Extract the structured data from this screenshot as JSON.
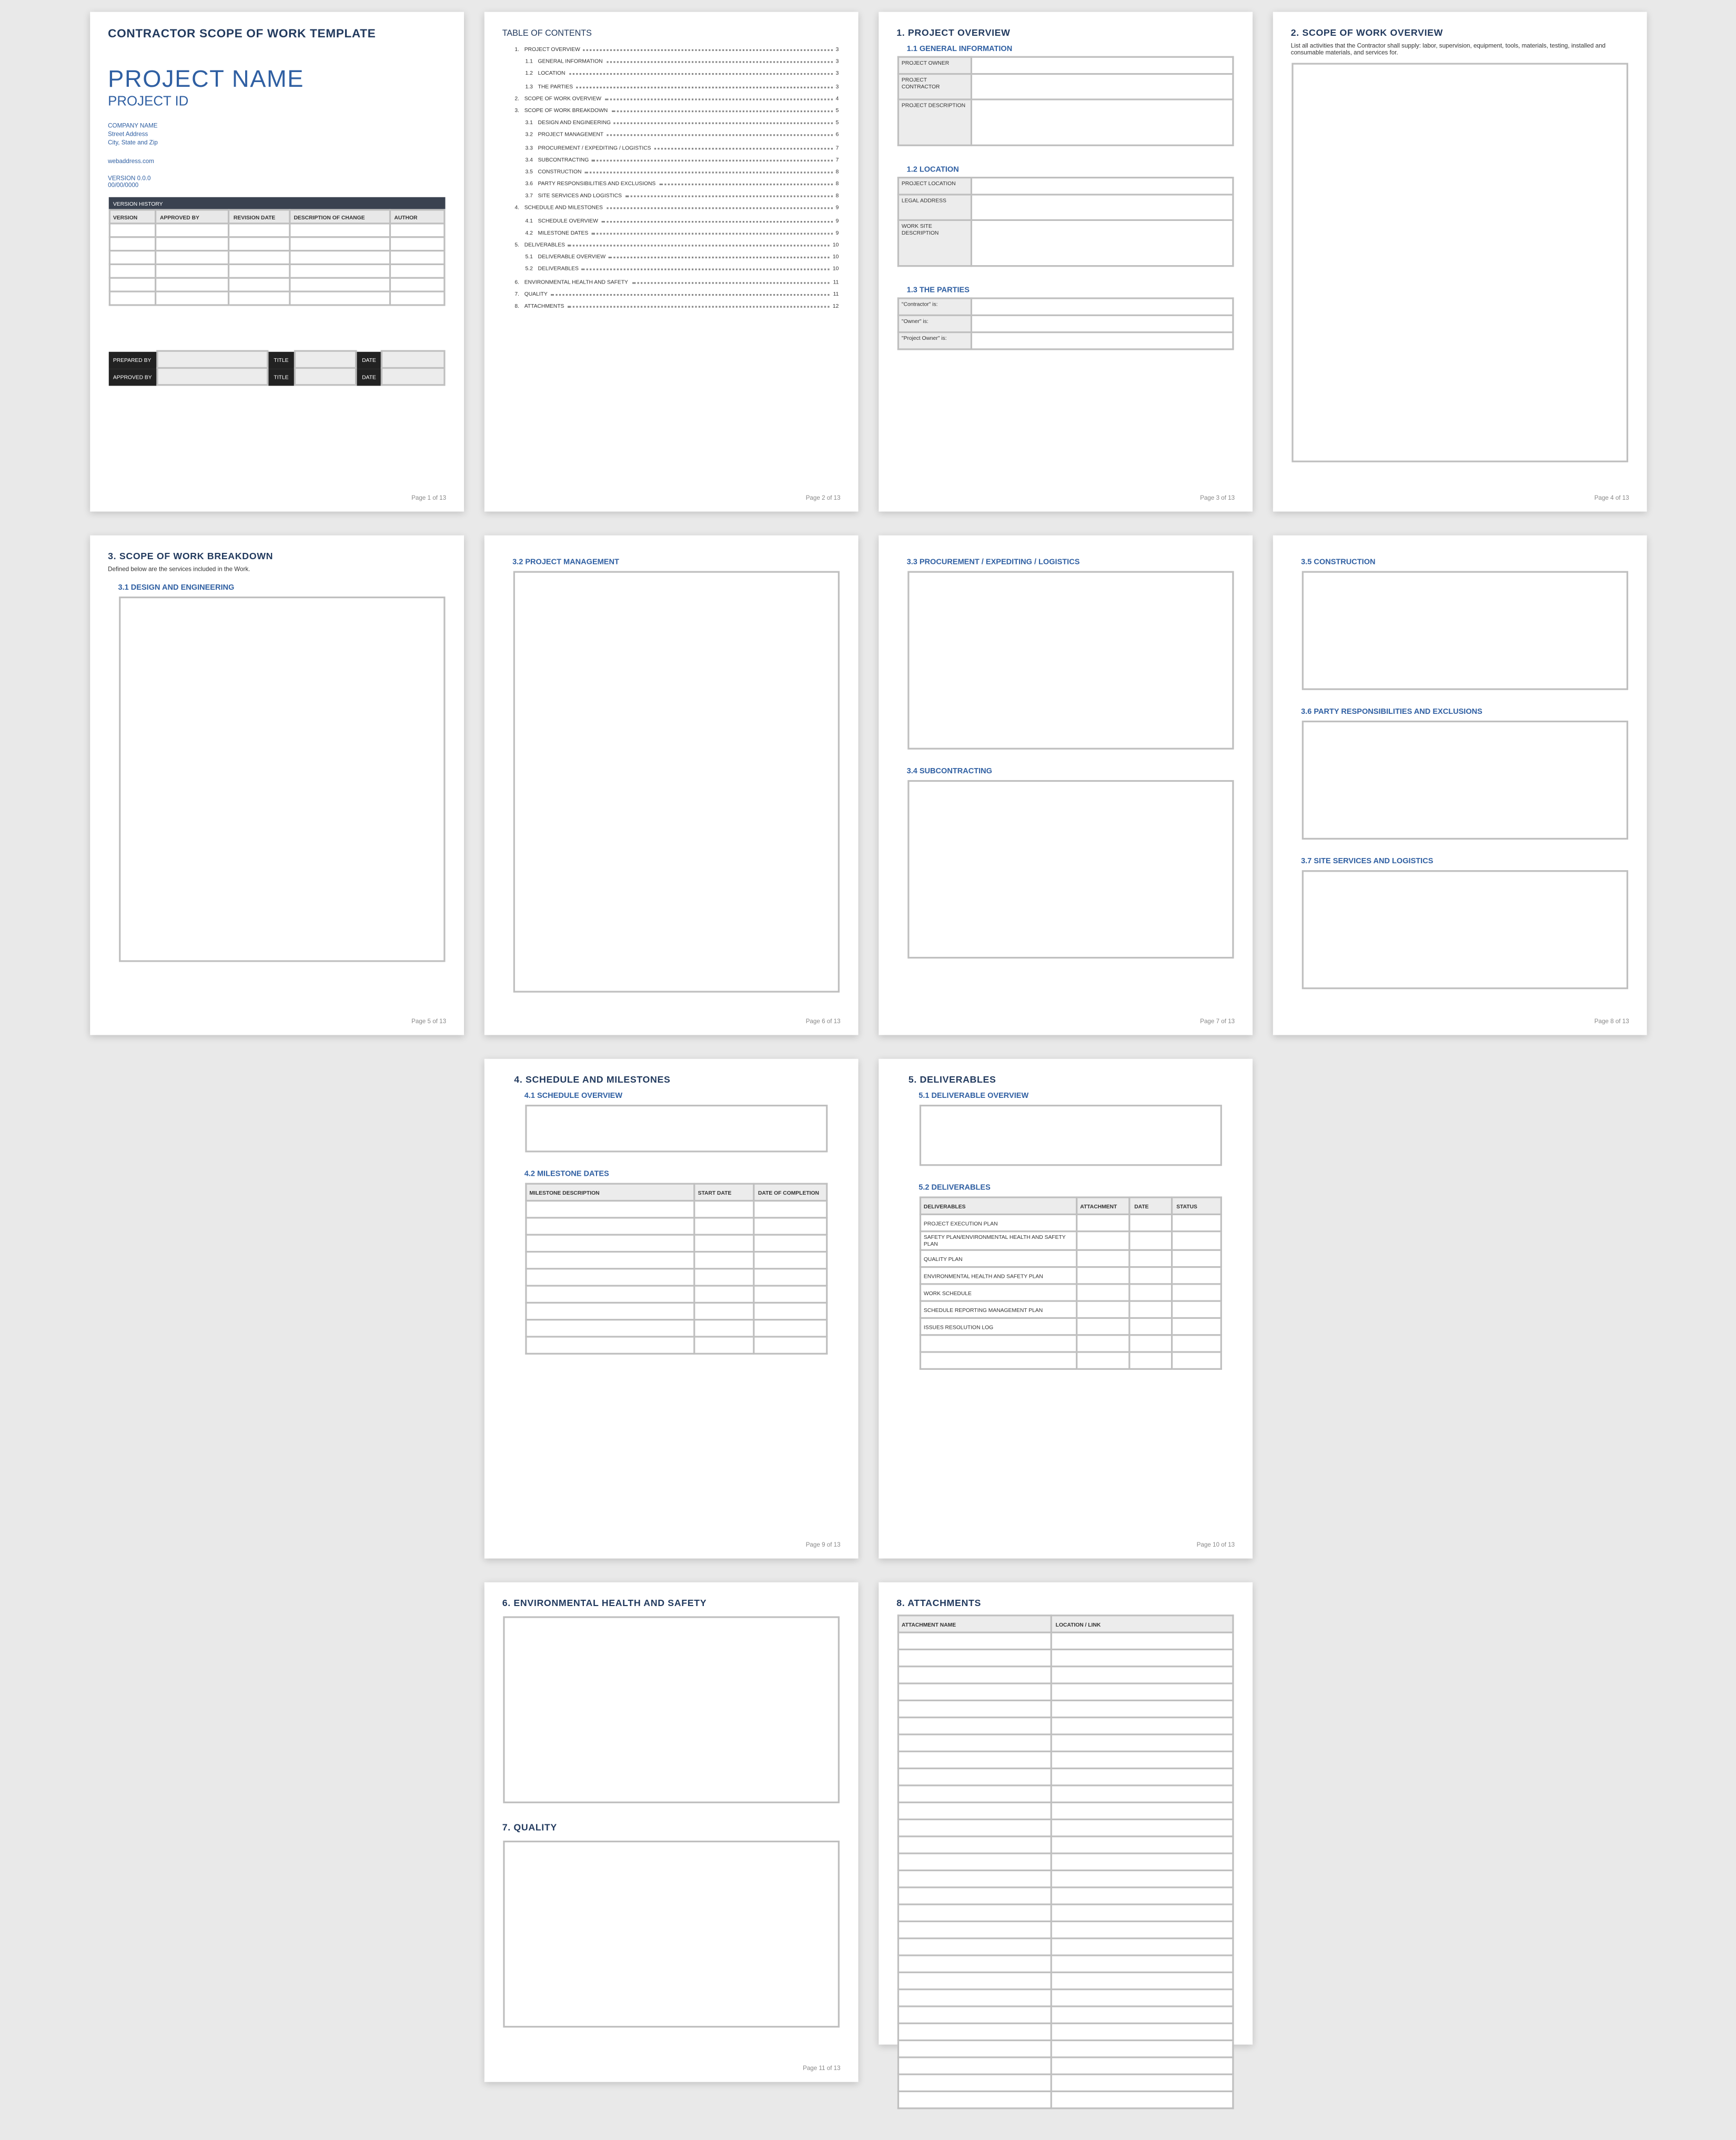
{
  "footer_prefix": "Page ",
  "footer_suffix": " of 13",
  "page1": {
    "doc_title": "CONTRACTOR SCOPE OF WORK TEMPLATE",
    "project_name": "PROJECT NAME",
    "project_id": "PROJECT ID",
    "company": "COMPANY NAME",
    "street": "Street Address",
    "city": "City, State and Zip",
    "web": "webaddress.com",
    "version": "VERSION 0.0.0",
    "ver_date": "00/00/0000",
    "vh_bar": "VERSION HISTORY",
    "vh_cols": [
      "VERSION",
      "APPROVED BY",
      "REVISION DATE",
      "DESCRIPTION OF CHANGE",
      "AUTHOR"
    ],
    "sign": {
      "prepared": "PREPARED BY",
      "approved": "APPROVED BY",
      "title": "TITLE",
      "date": "DATE"
    }
  },
  "page2": {
    "title": "TABLE OF CONTENTS",
    "items": [
      {
        "n": "1.",
        "t": "PROJECT OVERVIEW",
        "p": "3",
        "sub": false
      },
      {
        "n": "1.1",
        "t": "GENERAL INFORMATION",
        "p": "3",
        "sub": true
      },
      {
        "n": "1.2",
        "t": "LOCATION",
        "p": "3",
        "sub": true
      },
      {
        "n": "1.3",
        "t": "THE PARTIES",
        "p": "3",
        "sub": true
      },
      {
        "n": "2.",
        "t": "SCOPE OF WORK OVERVIEW",
        "p": "4",
        "sub": false
      },
      {
        "n": "3.",
        "t": "SCOPE OF WORK BREAKDOWN",
        "p": "5",
        "sub": false
      },
      {
        "n": "3.1",
        "t": "DESIGN AND ENGINEERING",
        "p": "5",
        "sub": true
      },
      {
        "n": "3.2",
        "t": "PROJECT MANAGEMENT",
        "p": "6",
        "sub": true
      },
      {
        "n": "3.3",
        "t": "PROCUREMENT / EXPEDITING / LOGISTICS",
        "p": "7",
        "sub": true
      },
      {
        "n": "3.4",
        "t": "SUBCONTRACTING",
        "p": "7",
        "sub": true
      },
      {
        "n": "3.5",
        "t": "CONSTRUCTION",
        "p": "8",
        "sub": true
      },
      {
        "n": "3.6",
        "t": "PARTY RESPONSIBILITIES AND EXCLUSIONS",
        "p": "8",
        "sub": true
      },
      {
        "n": "3.7",
        "t": "SITE SERVICES AND LOGISTICS",
        "p": "8",
        "sub": true
      },
      {
        "n": "4.",
        "t": "SCHEDULE AND MILESTONES",
        "p": "9",
        "sub": false
      },
      {
        "n": "4.1",
        "t": "SCHEDULE OVERVIEW",
        "p": "9",
        "sub": true
      },
      {
        "n": "4.2",
        "t": "MILESTONE DATES",
        "p": "9",
        "sub": true
      },
      {
        "n": "5.",
        "t": "DELIVERABLES",
        "p": "10",
        "sub": false
      },
      {
        "n": "5.1",
        "t": "DELIVERABLE OVERVIEW",
        "p": "10",
        "sub": true
      },
      {
        "n": "5.2",
        "t": "DELIVERABLES",
        "p": "10",
        "sub": true
      },
      {
        "n": "6.",
        "t": "ENVIRONMENTAL HEALTH AND SAFETY",
        "p": "11",
        "sub": false
      },
      {
        "n": "7.",
        "t": "QUALITY",
        "p": "11",
        "sub": false
      },
      {
        "n": "8.",
        "t": "ATTACHMENTS",
        "p": "12",
        "sub": false
      }
    ]
  },
  "page3": {
    "h1": "1.  PROJECT OVERVIEW",
    "h11": "1.1    GENERAL INFORMATION",
    "f_owner": "PROJECT OWNER",
    "f_contractor": "PROJECT CONTRACTOR",
    "f_desc": "PROJECT DESCRIPTION",
    "h12": "1.2    LOCATION",
    "f_loc": "PROJECT LOCATION",
    "f_legal": "LEGAL ADDRESS",
    "f_site": "WORK SITE DESCRIPTION",
    "h13": "1.3    THE PARTIES",
    "p_contractor": "\"Contractor\" is:",
    "p_owner": "\"Owner\" is:",
    "p_powner": "\"Project Owner\" is:"
  },
  "page4": {
    "h": "2.  SCOPE OF WORK OVERVIEW",
    "desc": "List all activities that the Contractor shall supply: labor, supervision, equipment, tools, materials, testing, installed and consumable materials, and services for."
  },
  "page5": {
    "h": "3.  SCOPE OF WORK BREAKDOWN",
    "note": "Defined below are the services included in the Work.",
    "h31": "3.1    DESIGN AND ENGINEERING"
  },
  "page6": {
    "h32": "3.2    PROJECT MANAGEMENT"
  },
  "page7": {
    "h33": "3.3    PROCUREMENT / EXPEDITING / LOGISTICS",
    "h34": "3.4    SUBCONTRACTING"
  },
  "page8": {
    "h35": "3.5    CONSTRUCTION",
    "h36": "3.6    PARTY RESPONSIBILITIES AND EXCLUSIONS",
    "h37": "3.7    SITE SERVICES AND LOGISTICS"
  },
  "page9": {
    "h": "4.  SCHEDULE AND MILESTONES",
    "h41": "4.1   SCHEDULE OVERVIEW",
    "h42": "4.2   MILESTONE DATES",
    "cols": [
      "MILESTONE DESCRIPTION",
      "START DATE",
      "DATE OF COMPLETION"
    ]
  },
  "page10": {
    "h": "5.  DELIVERABLES",
    "h51": "5.1   DELIVERABLE OVERVIEW",
    "h52": "5.2   DELIVERABLES",
    "cols": [
      "DELIVERABLES",
      "ATTACHMENT",
      "DATE",
      "STATUS"
    ],
    "rows": [
      "PROJECT EXECUTION PLAN",
      "SAFETY PLAN/ENVIRONMENTAL HEALTH AND SAFETY PLAN",
      "QUALITY PLAN",
      "ENVIRONMENTAL HEALTH AND SAFETY PLAN",
      "WORK SCHEDULE",
      "SCHEDULE REPORTING MANAGEMENT PLAN",
      "ISSUES RESOLUTION LOG"
    ]
  },
  "page11": {
    "h6": "6.  ENVIRONMENTAL HEALTH AND SAFETY",
    "h7": "7.  QUALITY"
  },
  "page12": {
    "h": "8.  ATTACHMENTS",
    "cols": [
      "ATTACHMENT NAME",
      "LOCATION / LINK"
    ]
  }
}
